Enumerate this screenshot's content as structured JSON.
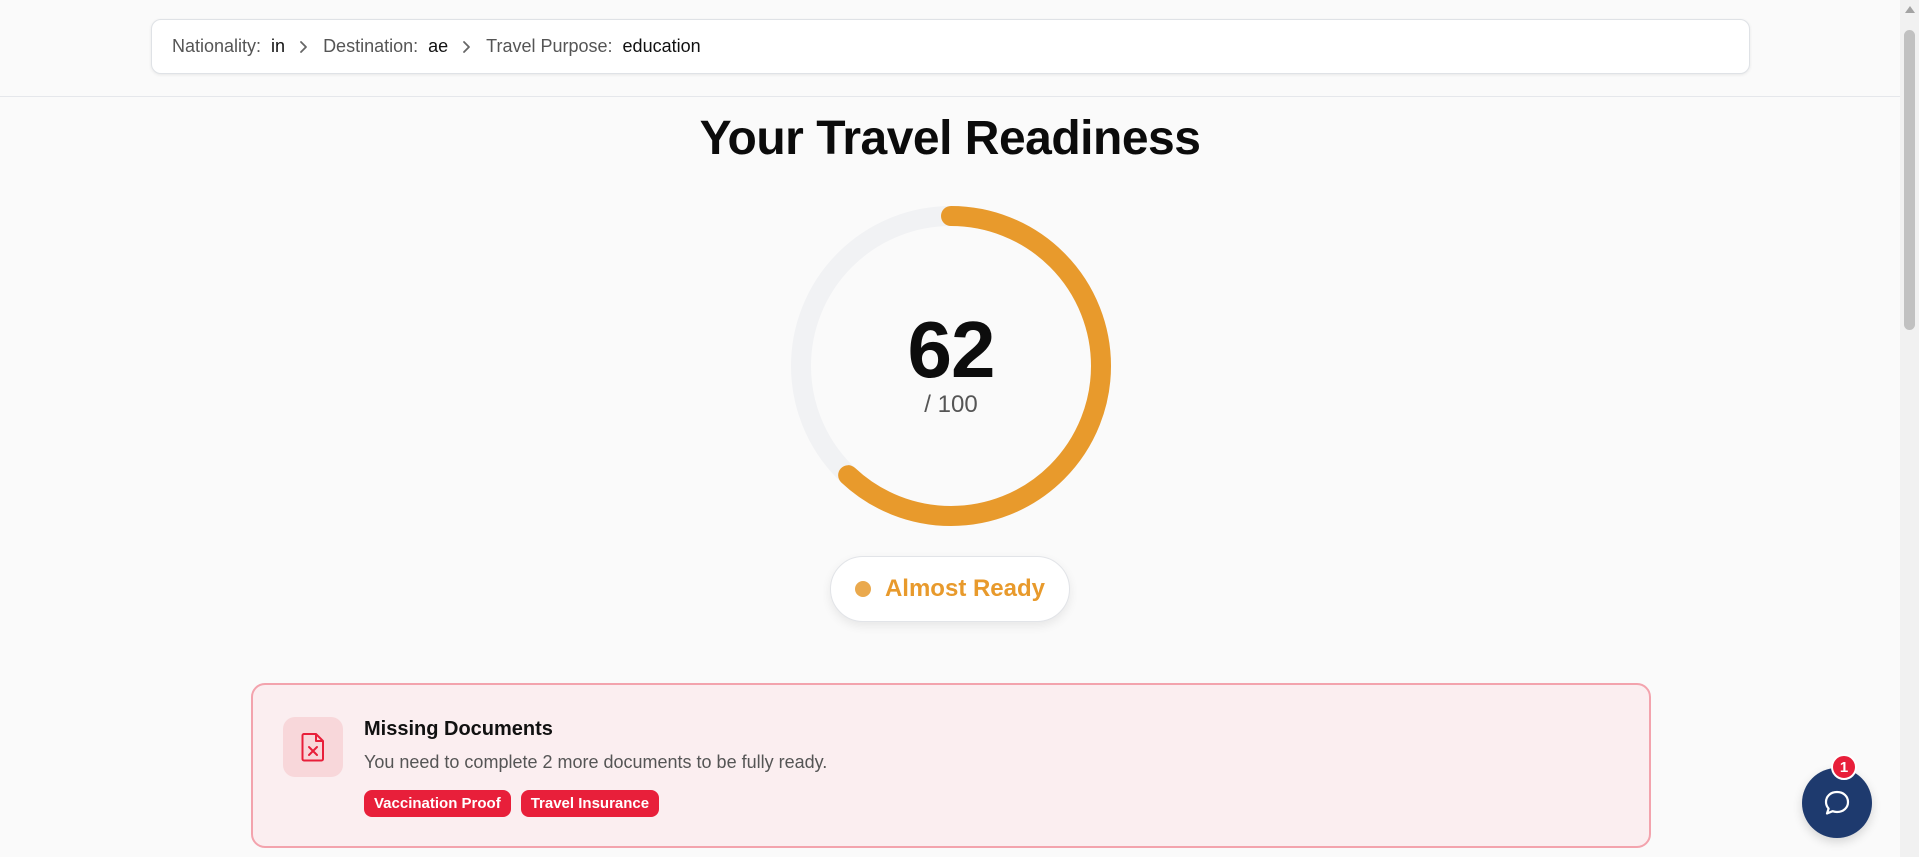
{
  "breadcrumb": {
    "items": [
      {
        "label": "Nationality:",
        "value": "in"
      },
      {
        "label": "Destination:",
        "value": "ae"
      },
      {
        "label": "Travel Purpose:",
        "value": "education"
      }
    ]
  },
  "main": {
    "title": "Your Travel Readiness",
    "score": "62",
    "score_max": "/ 100",
    "score_fraction": 0.62,
    "status_label": "Almost Ready"
  },
  "alert": {
    "title": "Missing Documents",
    "message": "You need to complete 2 more documents to be fully ready.",
    "tags": [
      "Vaccination Proof",
      "Travel Insurance"
    ],
    "icon": "file-x-icon"
  },
  "chat": {
    "icon": "chat-bubble-icon",
    "badge_count": "1"
  },
  "colors": {
    "accent": "#e89a2c",
    "danger": "#e81f3a",
    "chat_bg": "#1e3a6e",
    "track": "#f1f2f4"
  }
}
